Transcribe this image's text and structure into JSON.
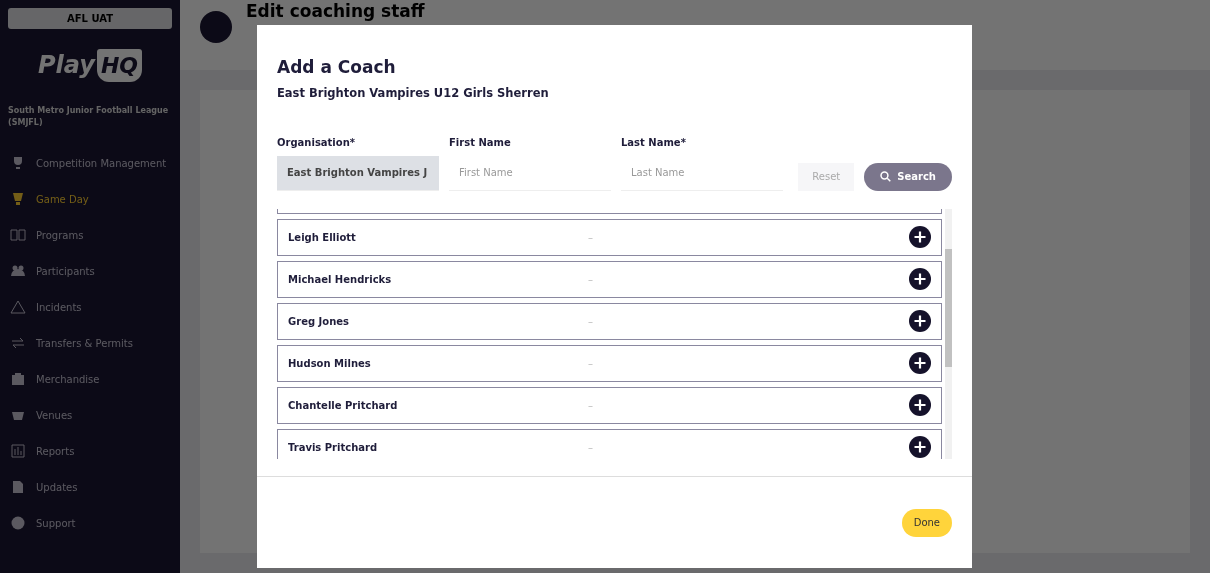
{
  "environment_badge": "AFL UAT",
  "logo": {
    "text": "Play",
    "badge": "HQ"
  },
  "organisation": "South Metro Junior Football League (SMJFL)",
  "sidebar": {
    "items": [
      {
        "label": "Competition Management",
        "selected": false
      },
      {
        "label": "Game Day",
        "selected": true
      },
      {
        "label": "Programs",
        "selected": false
      },
      {
        "label": "Participants",
        "selected": false
      },
      {
        "label": "Incidents",
        "selected": false
      },
      {
        "label": "Transfers & Permits",
        "selected": false
      },
      {
        "label": "Merchandise",
        "selected": false
      },
      {
        "label": "Venues",
        "selected": false
      },
      {
        "label": "Reports",
        "selected": false
      },
      {
        "label": "Updates",
        "selected": false
      },
      {
        "label": "Support",
        "selected": false
      }
    ]
  },
  "page": {
    "title": "Edit coaching staff"
  },
  "modal": {
    "title": "Add a Coach",
    "subtitle": "East Brighton Vampires U12 Girls Sherren",
    "fields": [
      {
        "label": "Organisation*",
        "value": "East Brighton Vampires J",
        "disabled": true
      },
      {
        "label": "First Name",
        "placeholder": "First Name",
        "disabled": false
      },
      {
        "label": "Last Name*",
        "placeholder": "Last Name",
        "disabled": false
      }
    ],
    "reset_button": "Reset",
    "search_button": "Search",
    "results": [
      {
        "name": "Leigh Elliott",
        "detail": "–"
      },
      {
        "name": "Michael Hendricks",
        "detail": "–"
      },
      {
        "name": "Greg Jones",
        "detail": "–"
      },
      {
        "name": "Hudson Milnes",
        "detail": "–"
      },
      {
        "name": "Chantelle Pritchard",
        "detail": "–"
      },
      {
        "name": "Travis Pritchard",
        "detail": "–"
      }
    ],
    "done_button": "Done"
  }
}
